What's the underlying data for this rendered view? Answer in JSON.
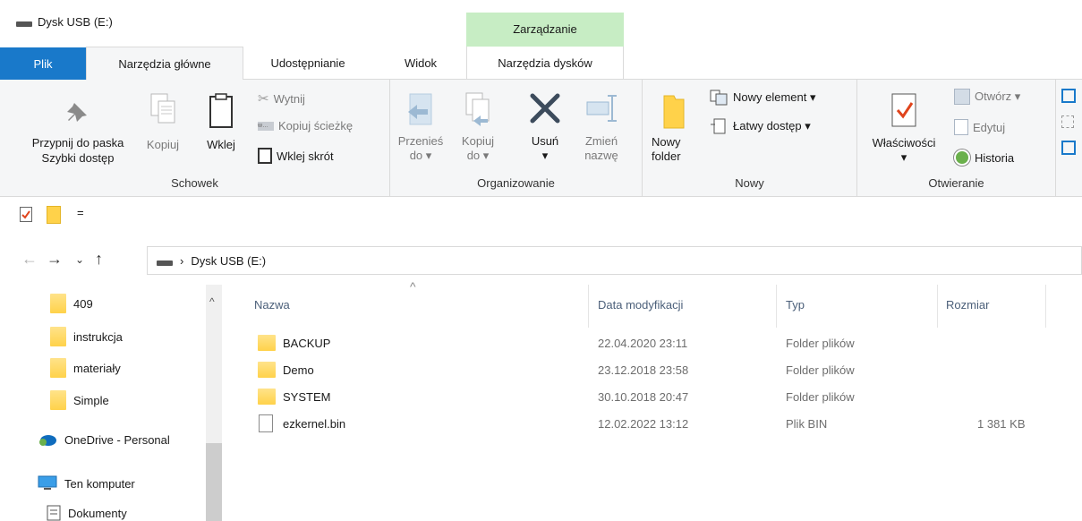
{
  "window": {
    "title": "Dysk USB (E:)",
    "context_label": "Zarządzanie"
  },
  "tabs": [
    {
      "label": "Plik"
    },
    {
      "label": "Narzędzia główne"
    },
    {
      "label": "Udostępnianie"
    },
    {
      "label": "Widok"
    },
    {
      "label": "Narzędzia dysków"
    }
  ],
  "ribbon": {
    "schowek": {
      "label": "Schowek",
      "pin": "Przypnij do paska\nSzybki dostęp",
      "copy": "Kopiuj",
      "paste": "Wklej",
      "cut": "Wytnij",
      "copy_path": "Kopiuj ścieżkę",
      "paste_shortcut": "Wklej skrót"
    },
    "organizowanie": {
      "label": "Organizowanie",
      "move_to": "Przenieś\ndo ▾",
      "copy_to": "Kopiuj\ndo ▾",
      "delete": "Usuń\n▾",
      "rename": "Zmień\nnazwę"
    },
    "nowy": {
      "label": "Nowy",
      "new_folder": "Nowy\nfolder",
      "new_item": "Nowy element ▾",
      "easy_access": "Łatwy dostęp ▾"
    },
    "otwieranie": {
      "label": "Otwieranie",
      "properties": "Właściwości\n▾",
      "open": "Otwórz ▾",
      "edit": "Edytuj",
      "history": "Historia"
    }
  },
  "qat": {
    "dropdown": "="
  },
  "address": {
    "path": "Dysk USB (E:)",
    "separator": "›"
  },
  "nav_pane": [
    {
      "label": "409",
      "icon": "folder-icon"
    },
    {
      "label": "instrukcja",
      "icon": "folder-icon"
    },
    {
      "label": "materiały",
      "icon": "folder-icon"
    },
    {
      "label": "Simple",
      "icon": "folder-icon"
    },
    {
      "label": "OneDrive - Personal",
      "icon": "onedrive-icon"
    },
    {
      "label": "Ten komputer",
      "icon": "computer-icon"
    },
    {
      "label": "Dokumenty",
      "icon": "documents-icon"
    }
  ],
  "columns": {
    "name": "Nazwa",
    "modified": "Data modyfikacji",
    "type": "Typ",
    "size": "Rozmiar"
  },
  "files": [
    {
      "name": "BACKUP",
      "modified": "22.04.2020 23:11",
      "type": "Folder plików",
      "size": "",
      "icon": "folder-icon"
    },
    {
      "name": "Demo",
      "modified": "23.12.2018 23:58",
      "type": "Folder plików",
      "size": "",
      "icon": "folder-icon"
    },
    {
      "name": "SYSTEM",
      "modified": "30.10.2018 20:47",
      "type": "Folder plików",
      "size": "",
      "icon": "folder-icon"
    },
    {
      "name": "ezkernel.bin",
      "modified": "12.02.2022 13:12",
      "type": "Plik BIN",
      "size": "1 381 KB",
      "icon": "file-icon"
    }
  ]
}
